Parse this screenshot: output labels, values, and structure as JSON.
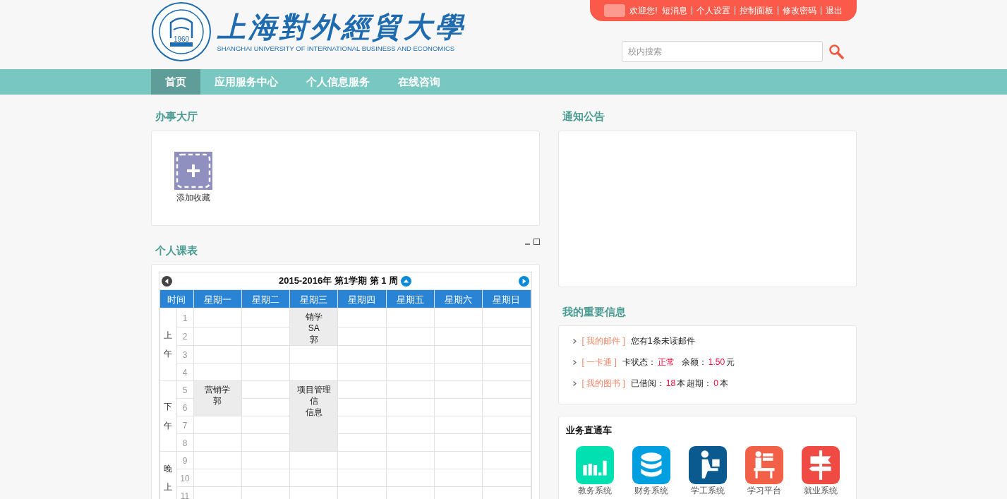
{
  "header": {
    "logo": {
      "seal_year": "1960",
      "title": "上海對外經貿大學",
      "subtitle": "SHANGHAI UNIVERSITY OF INTERNATIONAL BUSINESS AND ECONOMICS"
    },
    "welcome": "欢迎您!",
    "user_links": [
      "短消息",
      "个人设置",
      "控制面板",
      "修改密码",
      "退出"
    ],
    "search": {
      "placeholder": "校内搜索"
    }
  },
  "nav": [
    {
      "label": "首页",
      "selected": true
    },
    {
      "label": "应用服务中心",
      "selected": false
    },
    {
      "label": "个人信息服务",
      "selected": false
    },
    {
      "label": "在线咨询",
      "selected": false
    }
  ],
  "service_hall": {
    "title": "办事大厅",
    "items": [
      {
        "label": "添加收藏"
      }
    ]
  },
  "timetable": {
    "title": "个人课表",
    "week_title": "2015-2016年 第1学期 第 1 周",
    "columns": [
      "时间",
      "星期一",
      "星期二",
      "星期三",
      "星期四",
      "星期五",
      "星期六",
      "星期日"
    ],
    "sessions": [
      {
        "label": "上午",
        "periods": [
          {
            "number": "1",
            "cells": [
              {
                "kind": "empty"
              },
              {
                "kind": "empty"
              },
              {
                "kind": "course",
                "lines": [
                  "销学",
                  "SA",
                  "郭"
                ]
              },
              {
                "kind": "empty"
              },
              {
                "kind": "empty"
              },
              {
                "kind": "empty"
              },
              {
                "kind": "empty"
              }
            ]
          },
          {
            "number": "2",
            "cells": [
              {
                "kind": "empty"
              },
              {
                "kind": "empty"
              },
              {
                "kind": "continued"
              },
              {
                "kind": "empty"
              },
              {
                "kind": "empty"
              },
              {
                "kind": "empty"
              },
              {
                "kind": "empty"
              }
            ]
          },
          {
            "number": "3",
            "cells": [
              {
                "kind": "empty"
              },
              {
                "kind": "empty"
              },
              {
                "kind": "empty"
              },
              {
                "kind": "empty"
              },
              {
                "kind": "empty"
              },
              {
                "kind": "empty"
              },
              {
                "kind": "empty"
              }
            ]
          },
          {
            "number": "4",
            "cells": [
              {
                "kind": "empty"
              },
              {
                "kind": "empty"
              },
              {
                "kind": "empty"
              },
              {
                "kind": "empty"
              },
              {
                "kind": "empty"
              },
              {
                "kind": "empty"
              },
              {
                "kind": "empty"
              }
            ]
          }
        ]
      },
      {
        "label": "下午",
        "periods": [
          {
            "number": "5",
            "cells": [
              {
                "kind": "course",
                "lines": [
                  "营销学",
                  "郭"
                ]
              },
              {
                "kind": "empty"
              },
              {
                "kind": "course",
                "lines": [
                  "项目管理",
                  "信",
                  "信息"
                ]
              },
              {
                "kind": "empty"
              },
              {
                "kind": "empty"
              },
              {
                "kind": "empty"
              },
              {
                "kind": "empty"
              }
            ]
          },
          {
            "number": "6",
            "cells": [
              {
                "kind": "continued"
              },
              {
                "kind": "empty"
              },
              {
                "kind": "continued"
              },
              {
                "kind": "empty"
              },
              {
                "kind": "empty"
              },
              {
                "kind": "empty"
              },
              {
                "kind": "empty"
              }
            ]
          },
          {
            "number": "7",
            "cells": [
              {
                "kind": "empty"
              },
              {
                "kind": "empty"
              },
              {
                "kind": "continued"
              },
              {
                "kind": "empty"
              },
              {
                "kind": "empty"
              },
              {
                "kind": "empty"
              },
              {
                "kind": "empty"
              }
            ]
          },
          {
            "number": "8",
            "cells": [
              {
                "kind": "empty"
              },
              {
                "kind": "empty"
              },
              {
                "kind": "continued"
              },
              {
                "kind": "empty"
              },
              {
                "kind": "empty"
              },
              {
                "kind": "empty"
              },
              {
                "kind": "empty"
              }
            ]
          }
        ]
      },
      {
        "label": "晚上",
        "periods": [
          {
            "number": "9",
            "cells": [
              {
                "kind": "empty"
              },
              {
                "kind": "empty"
              },
              {
                "kind": "empty"
              },
              {
                "kind": "empty"
              },
              {
                "kind": "empty"
              },
              {
                "kind": "empty"
              },
              {
                "kind": "empty"
              }
            ]
          },
          {
            "number": "10",
            "cells": [
              {
                "kind": "empty"
              },
              {
                "kind": "empty"
              },
              {
                "kind": "empty"
              },
              {
                "kind": "empty"
              },
              {
                "kind": "empty"
              },
              {
                "kind": "empty"
              },
              {
                "kind": "empty"
              }
            ]
          },
          {
            "number": "11",
            "cells": [
              {
                "kind": "empty"
              },
              {
                "kind": "empty"
              },
              {
                "kind": "empty"
              },
              {
                "kind": "empty"
              },
              {
                "kind": "empty"
              },
              {
                "kind": "empty"
              },
              {
                "kind": "empty"
              }
            ]
          }
        ]
      }
    ]
  },
  "notices": {
    "title": "通知公告"
  },
  "important_info": {
    "title": "我的重要信息",
    "items": [
      {
        "tag": "[ 我的邮件 ]",
        "parts": [
          {
            "text": "您有1条未读邮件",
            "kind": "plain"
          }
        ]
      },
      {
        "tag": "[ 一卡通 ]",
        "parts": [
          {
            "text": "卡状态：",
            "kind": "plain"
          },
          {
            "text": "正常",
            "kind": "highlight"
          },
          {
            "text": "余额：",
            "kind": "plain"
          },
          {
            "text": "1.50",
            "kind": "highlight"
          },
          {
            "text": "元",
            "kind": "plain"
          }
        ]
      },
      {
        "tag": "[ 我的图书 ]",
        "parts": [
          {
            "text": "已借阅：",
            "kind": "plain"
          },
          {
            "text": "18",
            "kind": "highlight"
          },
          {
            "text": "本",
            "kind": "plain"
          },
          {
            "text": "超期：",
            "kind": "plain"
          },
          {
            "text": "0",
            "kind": "highlight"
          },
          {
            "text": "本",
            "kind": "plain"
          }
        ]
      }
    ]
  },
  "quick_links": {
    "title": "业务直通车",
    "items": [
      {
        "label": "教务系统",
        "kind": "chart",
        "color": "#00e0b0"
      },
      {
        "label": "财务系统",
        "kind": "database",
        "color": "#00a0e0"
      },
      {
        "label": "学工系统",
        "kind": "desk",
        "color": "#0a5a90"
      },
      {
        "label": "学习平台",
        "kind": "study",
        "color": "#f36048"
      },
      {
        "label": "就业系统",
        "kind": "signpost",
        "color": "#f04a44"
      }
    ]
  }
}
